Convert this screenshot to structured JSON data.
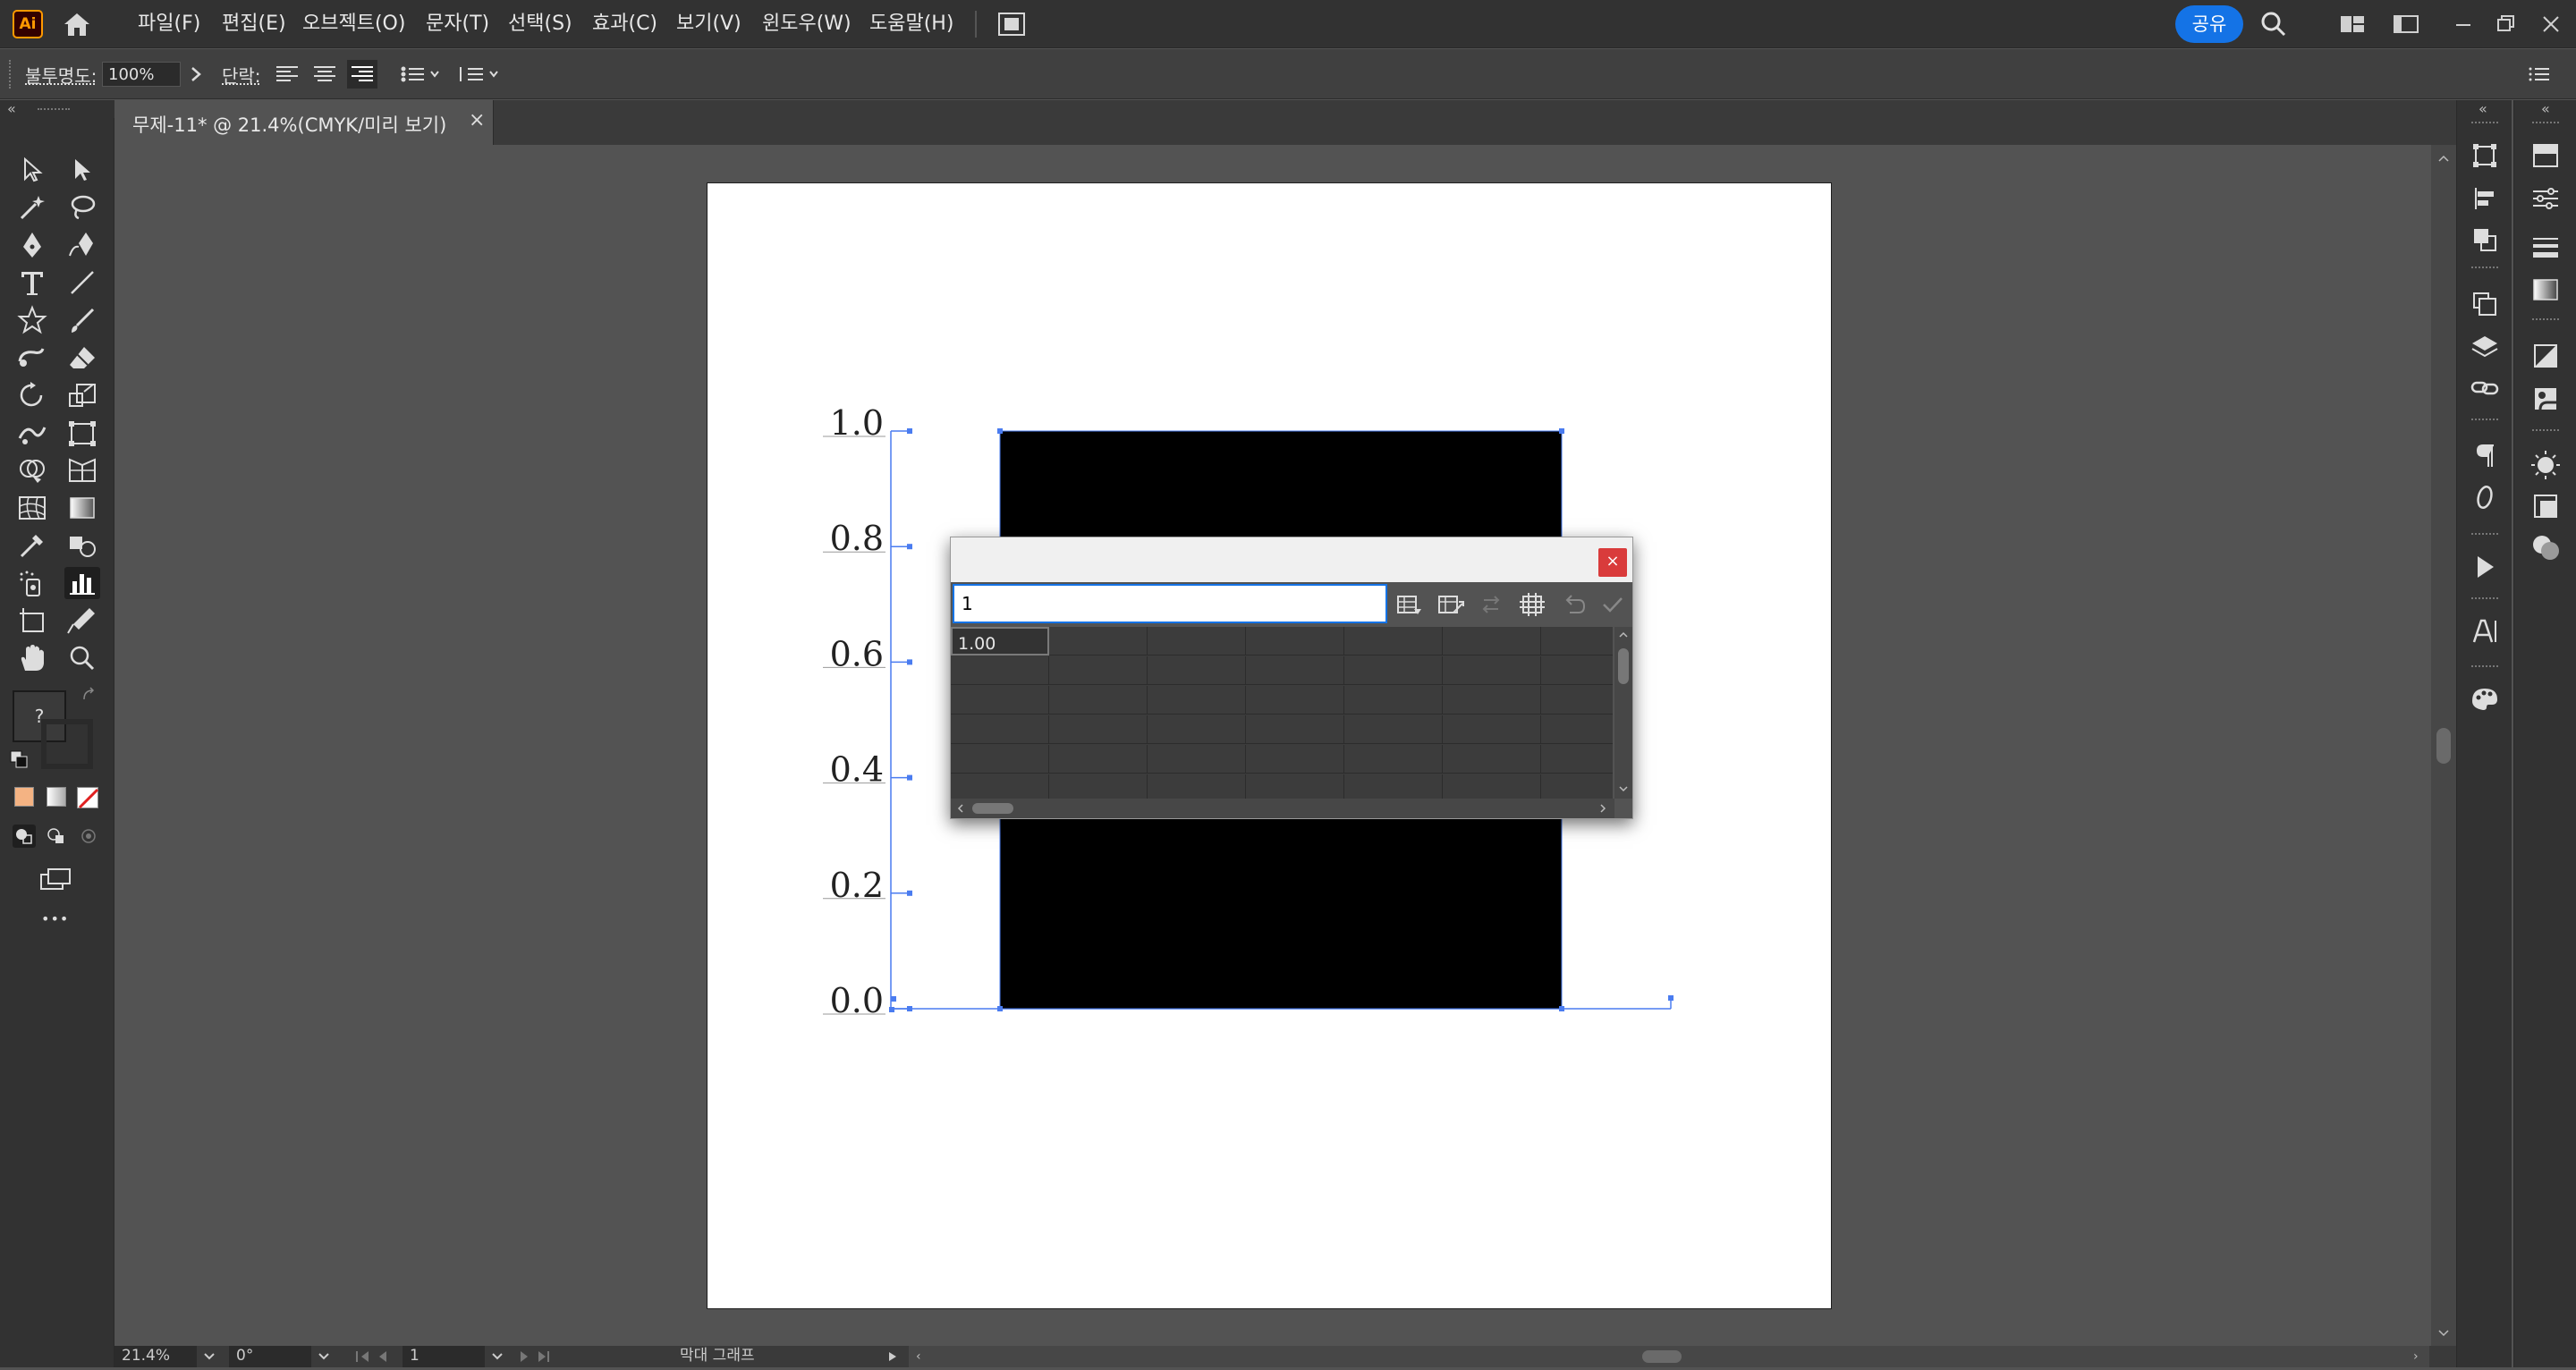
{
  "app": {
    "logo": "Ai",
    "menu": [
      "파일(F)",
      "편집(E)",
      "오브젝트(O)",
      "문자(T)",
      "선택(S)",
      "효과(C)",
      "보기(V)",
      "윈도우(W)",
      "도움말(H)"
    ],
    "share_label": "공유"
  },
  "control_bar": {
    "opacity_label": "불투명도:",
    "opacity_value": "100%",
    "paragraph_label": "단락:"
  },
  "document": {
    "tab_title": "무제-11* @ 21.4%(CMYK/미리 보기)",
    "close_glyph": "×"
  },
  "toolbar": {
    "fill_stroke_unknown": "?",
    "more_glyph": "•••"
  },
  "chart_data": {
    "type": "bar",
    "categories": [
      ""
    ],
    "values": [
      1.0
    ],
    "y_tick_labels": [
      "1.0",
      "0.8",
      "0.6",
      "0.4",
      "0.2",
      "0.0"
    ],
    "ylim": [
      0,
      1.0
    ],
    "bar_color": "#000000",
    "axis_selection_color": "#4a7cf0"
  },
  "graph_dialog": {
    "input_value": "1",
    "close_glyph": "×",
    "cells": [
      [
        "1.00",
        "",
        "",
        "",
        "",
        "",
        ""
      ]
    ],
    "visible_rows": 6
  },
  "statusbar": {
    "zoom": "21.4%",
    "rotation": "0°",
    "artboard_number": "1",
    "tool_name": "막대 그래프"
  },
  "colors": {
    "accent": "#1473e6",
    "ui_dark": "#323232",
    "canvas": "#535353",
    "close_red": "#d93b3b"
  }
}
